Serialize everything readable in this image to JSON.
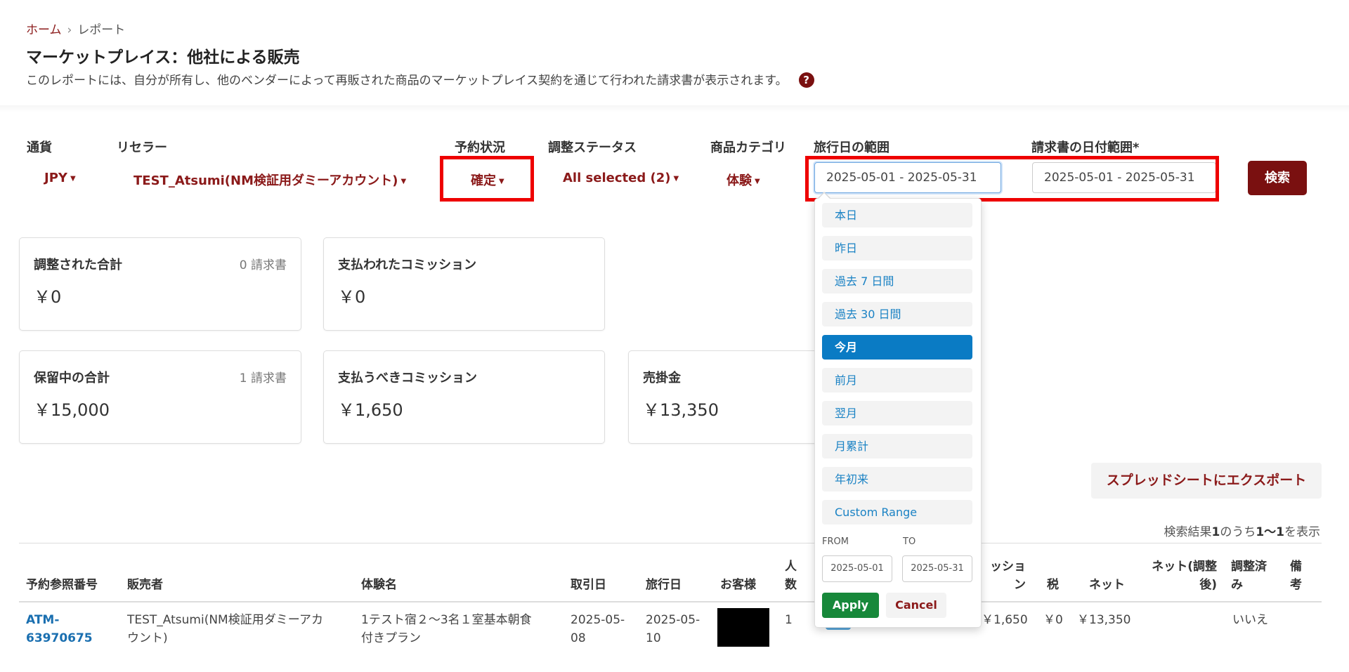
{
  "breadcrumb": {
    "home": "ホーム",
    "separator": "›",
    "current": "レポート"
  },
  "page": {
    "title": "マーケットプレイス：他社による販売",
    "subtitle": "このレポートには、自分が所有し、他のベンダーによって再販された商品のマーケットプレイス契約を通じて行われた請求書が表示されます。",
    "help_icon": "?"
  },
  "filters": {
    "currency": {
      "label": "通貨",
      "value": "JPY"
    },
    "reseller": {
      "label": "リセラー",
      "value": "TEST_Atsumi(NM検証用ダミーアカウント)"
    },
    "booking_status": {
      "label": "予約状況",
      "value": "確定"
    },
    "adjustment_status": {
      "label": "調整ステータス",
      "value": "All selected (2)"
    },
    "product_category": {
      "label": "商品カテゴリ",
      "value": "体験"
    },
    "travel_date_range": {
      "label": "旅行日の範囲",
      "value": "2025-05-01 - 2025-05-31"
    },
    "invoice_date_range": {
      "label": "請求書の日付範囲*",
      "value": "2025-05-01 - 2025-05-31"
    },
    "search_label": "検索"
  },
  "cards": {
    "adjusted_total": {
      "label": "調整された合計",
      "count": "0 請求書",
      "value": "￥0"
    },
    "paid_commission": {
      "label": "支払われたコミッション",
      "value": "￥0"
    },
    "held_total": {
      "label": "保留中の合計",
      "count": "1 請求書",
      "value": "￥15,000"
    },
    "payable_commission": {
      "label": "支払うべきコミッション",
      "value": "￥1,650"
    },
    "receivable": {
      "label": "売掛金",
      "value": "￥13,350"
    }
  },
  "export_label": "スプレッドシートにエクスポート",
  "results": {
    "prefix": "検索結果",
    "total": "1",
    "middle": "のうち",
    "range": "1〜1",
    "suffix": "を表示"
  },
  "table": {
    "headers": {
      "ref": "予約参照番号",
      "seller": "販売者",
      "experience": "体験名",
      "trade_date": "取引日",
      "travel_date": "旅行日",
      "customer": "お客様",
      "people_1": "人",
      "people_2": "数",
      "commission_1": "ッショ",
      "commission_2": "ン",
      "tax": "税",
      "net": "ネット",
      "net_adj_1": "ネット(調整",
      "net_adj_2": "後)",
      "adjusted_1": "調整済",
      "adjusted_2": "み",
      "notes_1": "備",
      "notes_2": "考"
    },
    "row": {
      "ref_1": "ATM-",
      "ref_2": "63970675",
      "seller_1": "TEST_Atsumi(NM検証用ダミーアカ",
      "seller_2": "ウント)",
      "experience_1": "1テスト宿２～3名１室基本朝食",
      "experience_2": "付きプラン",
      "trade_date_1": "2025-05-",
      "trade_date_2": "08",
      "travel_date_1": "2025-05-",
      "travel_date_2": "10",
      "people": "1",
      "commission": "￥1,650",
      "tax": "￥0",
      "net": "￥13,350",
      "adjusted": "いいえ"
    }
  },
  "date_picker": {
    "ranges": [
      "本日",
      "昨日",
      "過去 7 日間",
      "過去 30 日間",
      "今月",
      "前月",
      "翌月",
      "月累計",
      "年初来",
      "Custom Range"
    ],
    "selected_index": 4,
    "from_label": "FROM",
    "to_label": "TO",
    "from_value": "2025-05-01",
    "to_value": "2025-05-31",
    "apply_label": "Apply",
    "cancel_label": "Cancel"
  },
  "colors": {
    "brand": "#7a1010",
    "link": "#1a6fb0",
    "selected": "#0a7bc4",
    "apply": "#17883a",
    "highlight": "#ee0000"
  }
}
